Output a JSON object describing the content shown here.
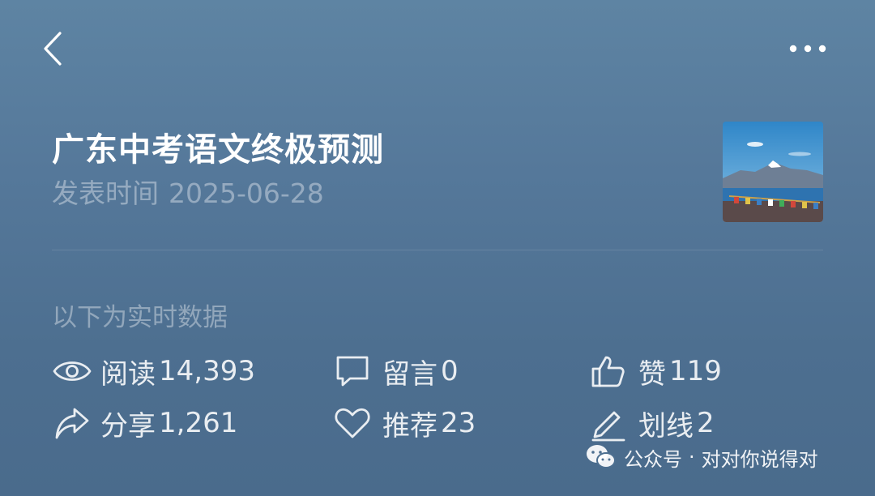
{
  "article": {
    "title": "广东中考语文终极预测",
    "publish_label": "发表时间",
    "publish_date": "2025-06-28"
  },
  "stats": {
    "note": "以下为实时数据",
    "items": [
      {
        "icon": "eye-icon",
        "label": "阅读",
        "value": "14,393"
      },
      {
        "icon": "comment-icon",
        "label": "留言",
        "value": "0"
      },
      {
        "icon": "thumbs-up-icon",
        "label": "赞",
        "value": "119"
      },
      {
        "icon": "share-icon",
        "label": "分享",
        "value": "1,261"
      },
      {
        "icon": "heart-icon",
        "label": "推荐",
        "value": "23"
      },
      {
        "icon": "pencil-icon",
        "label": "划线",
        "value": "2"
      }
    ]
  },
  "watermark": {
    "icon": "wechat-icon",
    "prefix": "公众号",
    "separator": "·",
    "account": "对对你说得对"
  }
}
